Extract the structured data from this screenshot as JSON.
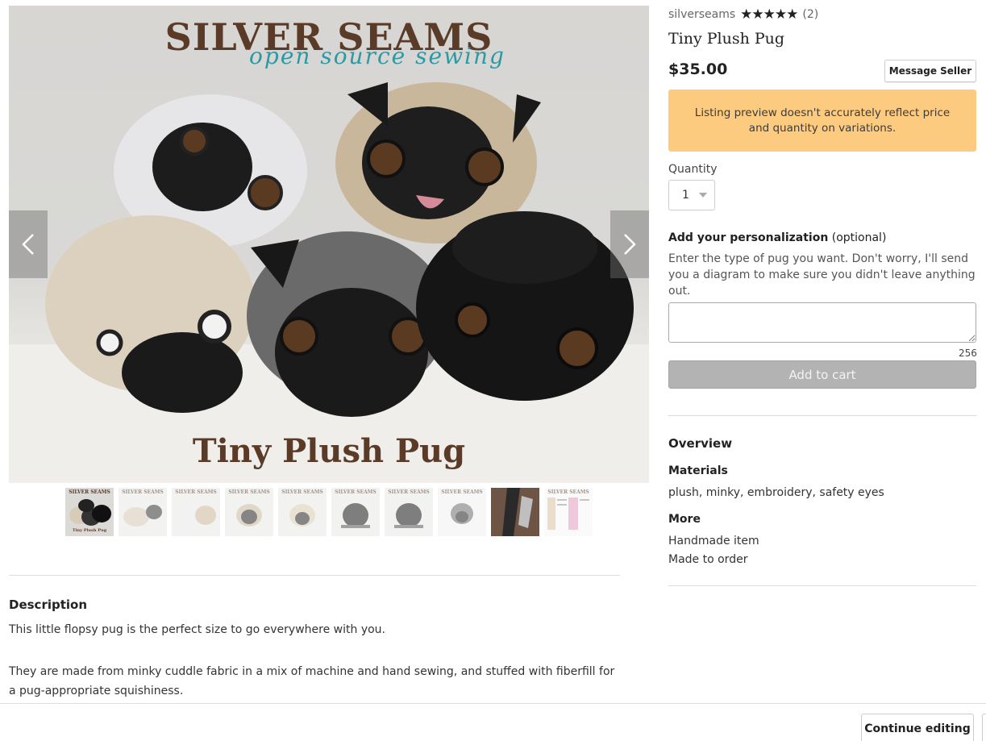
{
  "hero": {
    "brand": "SILVER SEAMS",
    "tagline": "open source sewing",
    "caption": "Tiny Plush Pug"
  },
  "gallery": {
    "prev_icon": "chevron-left-icon",
    "next_icon": "chevron-right-icon",
    "thumbnails": [
      {
        "brand": "SILVER SEAMS",
        "caption": "Tiny Plush Pug"
      },
      {
        "brand": "SILVER SEAMS",
        "caption": ""
      },
      {
        "brand": "SILVER SEAMS",
        "caption": ""
      },
      {
        "brand": "SILVER SEAMS",
        "caption": ""
      },
      {
        "brand": "SILVER SEAMS",
        "caption": ""
      },
      {
        "brand": "SILVER SEAMS",
        "caption": ""
      },
      {
        "brand": "SILVER SEAMS",
        "caption": ""
      },
      {
        "brand": "SILVER SEAMS",
        "caption": ""
      },
      {
        "brand": "",
        "caption": ""
      },
      {
        "brand": "SILVER SEAMS",
        "caption": ""
      }
    ]
  },
  "description": {
    "title": "Description",
    "p1": "This little flopsy pug is the perfect size to go everywhere with you.",
    "p2": "They are made from minky cuddle fabric in a mix of machine and hand sewing, and stuffed with fiberfill for a pug-appropriate squishiness."
  },
  "listing": {
    "shop_name": "silverseams",
    "rating_stars": "★★★★★",
    "rating_count": "(2)",
    "title": "Tiny Plush Pug",
    "price": "$35.00",
    "message_seller": "Message Seller",
    "notice": "Listing preview doesn't accurately reflect price and quantity on variations.",
    "quantity_label": "Quantity",
    "quantity_value": "1",
    "personalization_label": "Add your personalization",
    "personalization_optional": "(optional)",
    "personalization_hint": "Enter the type of pug you want. Don't worry, I'll send you a diagram to make sure you didn't leave anything out.",
    "char_count": "256",
    "add_to_cart": "Add to cart"
  },
  "overview": {
    "title": "Overview",
    "materials_title": "Materials",
    "materials": "plush, minky, embroidery, safety eyes",
    "more_title": "More",
    "more_items": [
      "Handmade item",
      "Made to order"
    ]
  },
  "footer": {
    "continue_editing": "Continue editing"
  },
  "colors": {
    "notice_bg": "#fdcb80",
    "brand_brown": "#5a3b28",
    "brand_teal": "#2a9aa5",
    "disabled_button": "#b3b3b3"
  }
}
